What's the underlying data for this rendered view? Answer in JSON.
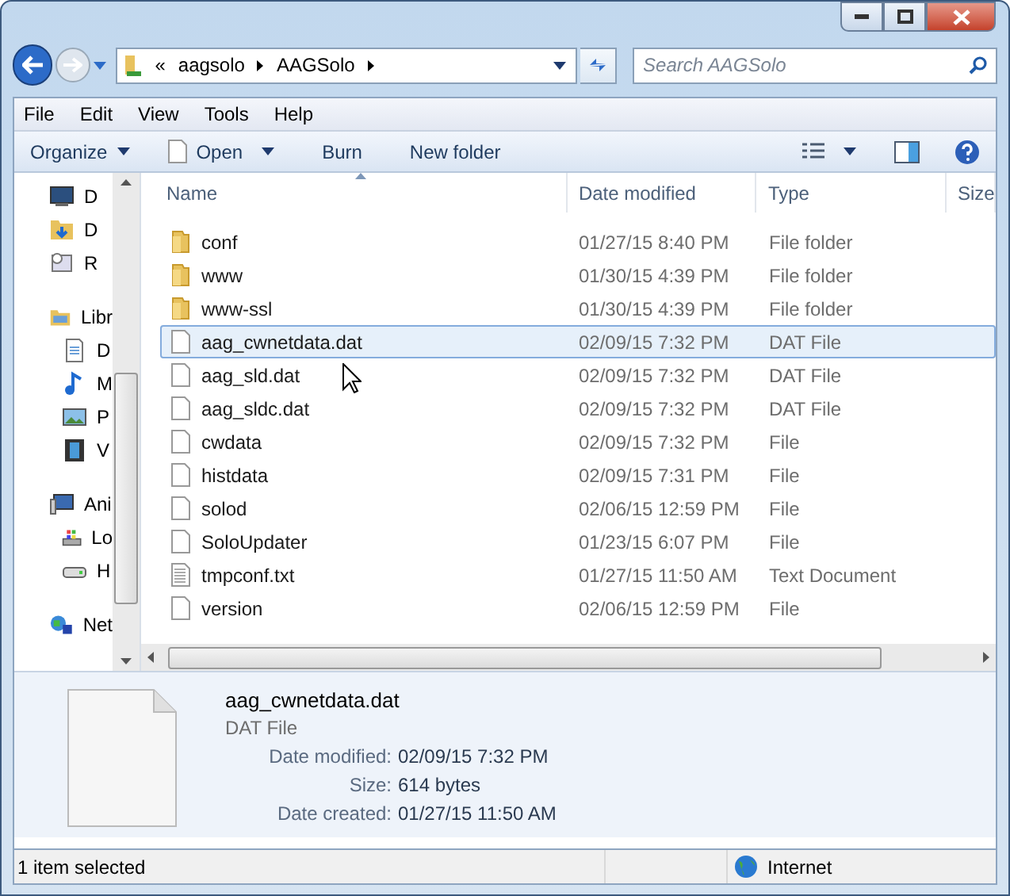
{
  "navigation": {
    "back_enabled": true,
    "forward_enabled": false
  },
  "address": {
    "overflow": "«",
    "crumbs": [
      "aagsolo",
      "AAGSolo"
    ]
  },
  "search": {
    "placeholder": "Search AAGSolo"
  },
  "menu": [
    "File",
    "Edit",
    "View",
    "Tools",
    "Help"
  ],
  "toolbar": [
    {
      "label": "Organize",
      "kind": "menu"
    },
    {
      "label": "Open",
      "kind": "open"
    },
    {
      "label": "Burn",
      "kind": "plain"
    },
    {
      "label": "New folder",
      "kind": "plain"
    }
  ],
  "sidebar": {
    "items": [
      {
        "label": "D"
      },
      {
        "label": "D"
      },
      {
        "label": "R"
      },
      {
        "label": "Libr",
        "children": [
          {
            "label": "D"
          },
          {
            "label": "M"
          },
          {
            "label": "P"
          },
          {
            "label": "V"
          }
        ]
      },
      {
        "label": "Ani",
        "children": [
          {
            "label": "Lo"
          },
          {
            "label": "H"
          }
        ]
      },
      {
        "label": "Net"
      }
    ]
  },
  "table": {
    "columns": [
      "Name",
      "Date modified",
      "Type",
      "Size"
    ],
    "rows": [
      {
        "name": "conf",
        "date": "01/27/15 8:40 PM",
        "type": "File folder",
        "kind": "folder",
        "selected": false
      },
      {
        "name": "www",
        "date": "01/30/15 4:39 PM",
        "type": "File folder",
        "kind": "folder",
        "selected": false
      },
      {
        "name": "www-ssl",
        "date": "01/30/15 4:39 PM",
        "type": "File folder",
        "kind": "folder",
        "selected": false
      },
      {
        "name": "aag_cwnetdata.dat",
        "date": "02/09/15 7:32 PM",
        "type": "DAT File",
        "kind": "file",
        "selected": true
      },
      {
        "name": "aag_sld.dat",
        "date": "02/09/15 7:32 PM",
        "type": "DAT File",
        "kind": "file",
        "selected": false
      },
      {
        "name": "aag_sldc.dat",
        "date": "02/09/15 7:32 PM",
        "type": "DAT File",
        "kind": "file",
        "selected": false
      },
      {
        "name": "cwdata",
        "date": "02/09/15 7:32 PM",
        "type": "File",
        "kind": "file",
        "selected": false
      },
      {
        "name": "histdata",
        "date": "02/09/15 7:31 PM",
        "type": "File",
        "kind": "file",
        "selected": false
      },
      {
        "name": "solod",
        "date": "02/06/15 12:59 PM",
        "type": "File",
        "kind": "file",
        "selected": false
      },
      {
        "name": "SoloUpdater",
        "date": "01/23/15 6:07 PM",
        "type": "File",
        "kind": "file",
        "selected": false
      },
      {
        "name": "tmpconf.txt",
        "date": "01/27/15 11:50 AM",
        "type": "Text Document",
        "kind": "text",
        "selected": false
      },
      {
        "name": "version",
        "date": "02/06/15 12:59 PM",
        "type": "File",
        "kind": "file",
        "selected": false
      }
    ]
  },
  "details": {
    "name": "aag_cwnetdata.dat",
    "type": "DAT File",
    "fields": [
      {
        "label": "Date modified:",
        "value": "02/09/15 7:32 PM"
      },
      {
        "label": "Size:",
        "value": "614 bytes"
      },
      {
        "label": "Date created:",
        "value": "01/27/15 11:50 AM"
      }
    ]
  },
  "status_bar": {
    "selection": "1 item selected",
    "zone": "Internet"
  }
}
